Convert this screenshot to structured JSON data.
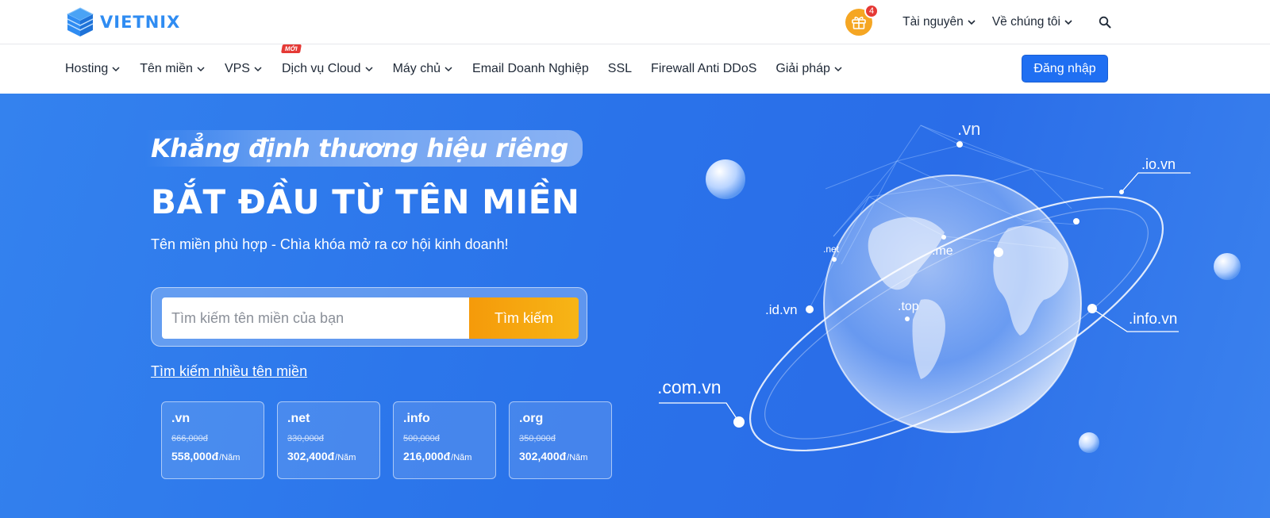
{
  "brand": {
    "name": "VIETNIX"
  },
  "topbar": {
    "gift_count": "4",
    "links": [
      {
        "label": "Tài nguyên"
      },
      {
        "label": "Về chúng tôi"
      }
    ]
  },
  "nav": {
    "items": [
      {
        "label": "Hosting"
      },
      {
        "label": "Tên miền"
      },
      {
        "label": "VPS"
      },
      {
        "label": "Dịch vụ Cloud",
        "badge": "MỚI"
      },
      {
        "label": "Máy chủ"
      },
      {
        "label": "Email Doanh Nghiệp"
      },
      {
        "label": "SSL"
      },
      {
        "label": "Firewall Anti DDoS"
      },
      {
        "label": "Giải pháp"
      }
    ],
    "login_label": "Đăng nhập"
  },
  "hero": {
    "tagline": "Khẳng định thương hiệu riêng",
    "headline": "BẮT ĐẦU TỪ TÊN MIỀN",
    "subline": "Tên miền phù hợp - Chìa khóa mở ra cơ hội kinh doanh!",
    "search": {
      "placeholder": "Tìm kiếm tên miền của bạn",
      "button_label": "Tìm kiếm"
    },
    "multi_search_label": "Tìm kiếm nhiều tên miền",
    "domain_cards": [
      {
        "ext": ".vn",
        "old_price": "666,000đ",
        "price": "558,000đ",
        "unit": "/Năm"
      },
      {
        "ext": ".net",
        "old_price": "330,000đ",
        "price": "302,400đ",
        "unit": "/Năm"
      },
      {
        "ext": ".info",
        "old_price": "500,000đ",
        "price": "216,000đ",
        "unit": "/Năm"
      },
      {
        "ext": ".org",
        "old_price": "350,000đ",
        "price": "302,400đ",
        "unit": "/Năm"
      }
    ],
    "globe_labels": {
      "vn": ".vn",
      "io_vn": ".io.vn",
      "net": ".net",
      "me": ".me",
      "id_vn": ".id.vn",
      "top": ".top",
      "info_vn": ".info.vn",
      "com_vn": ".com.vn"
    }
  },
  "colors": {
    "brand_blue": "#2f8cf2",
    "login_blue": "#1f6ff2",
    "hero_blue": "#2a73ea",
    "search_orange": "#f59a0a",
    "gift_orange": "#f5a623",
    "badge_red": "#e53935"
  },
  "icons": {
    "logo": "stacked-cube-logo-icon",
    "gift": "gift-icon",
    "search": "search-icon",
    "dropdown": "chevron-down-icon"
  }
}
